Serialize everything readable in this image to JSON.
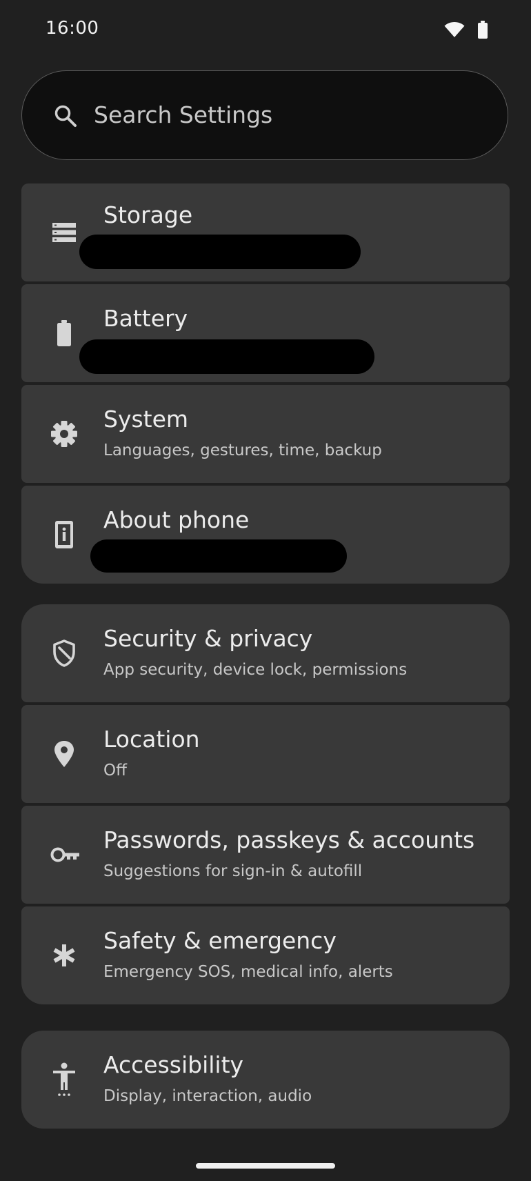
{
  "status_bar": {
    "time": "16:00",
    "icons": [
      "wifi-icon",
      "battery-icon"
    ]
  },
  "search": {
    "placeholder": "Search Settings"
  },
  "groups": [
    {
      "items": [
        {
          "title": "Storage",
          "subtitle": "",
          "icon": "storage-icon"
        },
        {
          "title": "Battery",
          "subtitle": "",
          "icon": "battery-icon"
        },
        {
          "title": "System",
          "subtitle": "Languages, gestures, time, backup",
          "icon": "gear-icon"
        },
        {
          "title": "About phone",
          "subtitle": "",
          "icon": "info-icon"
        }
      ]
    },
    {
      "items": [
        {
          "title": "Security & privacy",
          "subtitle": "App security, device lock, permissions",
          "icon": "shield-icon"
        },
        {
          "title": "Location",
          "subtitle": "Off",
          "icon": "location-pin-icon"
        },
        {
          "title": "Passwords, passkeys & accounts",
          "subtitle": "Suggestions for sign-in & autofill",
          "icon": "key-icon"
        },
        {
          "title": "Safety & emergency",
          "subtitle": "Emergency SOS, medical info, alerts",
          "icon": "asterisk-icon"
        }
      ]
    },
    {
      "items": [
        {
          "title": "Accessibility",
          "subtitle": "Display, interaction, audio",
          "icon": "accessibility-icon"
        }
      ]
    }
  ],
  "colors": {
    "background": "#202020",
    "tile": "#393939",
    "search_bg": "#0f0f0f",
    "text_primary": "#ececec",
    "text_secondary": "#c8c8c8"
  }
}
